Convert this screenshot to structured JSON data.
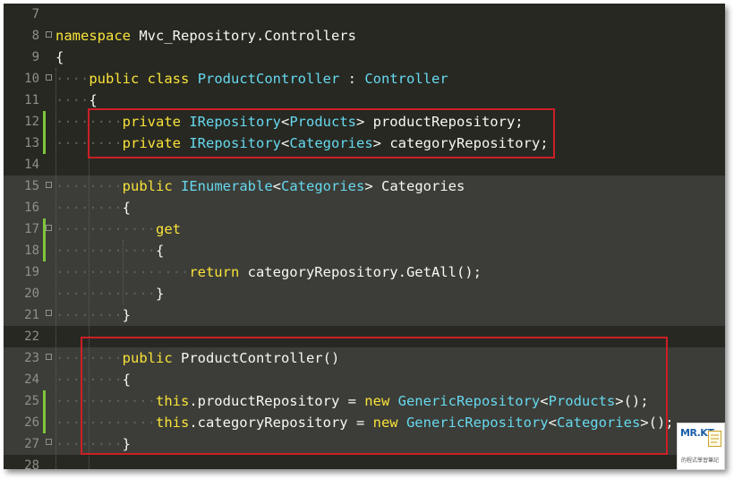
{
  "editor": {
    "lines": [
      {
        "num": "7",
        "indent": 0,
        "tokens": []
      },
      {
        "num": "8",
        "indent": 0,
        "fold": "open",
        "tokens": [
          {
            "t": "namespace",
            "c": "kw"
          },
          {
            "t": " Mvc_Repository.Controllers",
            "c": "pl"
          }
        ]
      },
      {
        "num": "9",
        "indent": 0,
        "tokens": [
          {
            "t": "{",
            "c": "pl"
          }
        ]
      },
      {
        "num": "10",
        "indent": 1,
        "fold": "open",
        "tokens": [
          {
            "t": "public",
            "c": "kw"
          },
          {
            "t": " ",
            "c": "pl"
          },
          {
            "t": "class",
            "c": "kw"
          },
          {
            "t": " ",
            "c": "pl"
          },
          {
            "t": "ProductController",
            "c": "ty"
          },
          {
            "t": " : ",
            "c": "pl"
          },
          {
            "t": "Controller",
            "c": "ty"
          }
        ]
      },
      {
        "num": "11",
        "indent": 1,
        "tokens": [
          {
            "t": "{",
            "c": "pl"
          }
        ]
      },
      {
        "num": "12",
        "indent": 2,
        "modified": true,
        "tokens": [
          {
            "t": "private",
            "c": "kw"
          },
          {
            "t": " ",
            "c": "pl"
          },
          {
            "t": "IRepository",
            "c": "ty"
          },
          {
            "t": "<",
            "c": "pl"
          },
          {
            "t": "Products",
            "c": "ty"
          },
          {
            "t": "> productRepository;",
            "c": "pl"
          }
        ]
      },
      {
        "num": "13",
        "indent": 2,
        "modified": true,
        "tokens": [
          {
            "t": "private",
            "c": "kw"
          },
          {
            "t": " ",
            "c": "pl"
          },
          {
            "t": "IRepository",
            "c": "ty"
          },
          {
            "t": "<",
            "c": "pl"
          },
          {
            "t": "Categories",
            "c": "ty"
          },
          {
            "t": "> categoryRepository;",
            "c": "pl"
          }
        ]
      },
      {
        "num": "14",
        "indent": 0,
        "tokens": []
      },
      {
        "num": "15",
        "indent": 2,
        "highlight": true,
        "fold": "open",
        "tokens": [
          {
            "t": "public",
            "c": "kw"
          },
          {
            "t": " ",
            "c": "pl"
          },
          {
            "t": "IEnumerable",
            "c": "ty"
          },
          {
            "t": "<",
            "c": "pl"
          },
          {
            "t": "Categories",
            "c": "ty"
          },
          {
            "t": "> Categories",
            "c": "pl"
          }
        ]
      },
      {
        "num": "16",
        "indent": 2,
        "highlight": true,
        "tokens": [
          {
            "t": "{",
            "c": "pl"
          }
        ]
      },
      {
        "num": "17",
        "indent": 3,
        "highlight": true,
        "modified": true,
        "fold": "open",
        "tokens": [
          {
            "t": "get",
            "c": "kw"
          }
        ]
      },
      {
        "num": "18",
        "indent": 3,
        "highlight": true,
        "modified": true,
        "tokens": [
          {
            "t": "{",
            "c": "pl"
          }
        ]
      },
      {
        "num": "19",
        "indent": 4,
        "highlight": true,
        "tokens": [
          {
            "t": "return",
            "c": "kw"
          },
          {
            "t": " categoryRepository.GetAll();",
            "c": "pl"
          }
        ]
      },
      {
        "num": "20",
        "indent": 3,
        "highlight": true,
        "tokens": [
          {
            "t": "}",
            "c": "pl"
          }
        ]
      },
      {
        "num": "21",
        "indent": 2,
        "highlight": true,
        "fold": "end",
        "tokens": [
          {
            "t": "}",
            "c": "pl"
          }
        ]
      },
      {
        "num": "22",
        "indent": 0,
        "tokens": []
      },
      {
        "num": "23",
        "indent": 2,
        "highlight": true,
        "fold": "open",
        "tokens": [
          {
            "t": "public",
            "c": "kw"
          },
          {
            "t": " ProductController()",
            "c": "pl"
          }
        ]
      },
      {
        "num": "24",
        "indent": 2,
        "highlight": true,
        "tokens": [
          {
            "t": "{",
            "c": "pl"
          }
        ]
      },
      {
        "num": "25",
        "indent": 3,
        "highlight": true,
        "modified": true,
        "tokens": [
          {
            "t": "this",
            "c": "kw"
          },
          {
            "t": ".productRepository = ",
            "c": "pl"
          },
          {
            "t": "new",
            "c": "kw"
          },
          {
            "t": " ",
            "c": "pl"
          },
          {
            "t": "GenericRepository",
            "c": "ty"
          },
          {
            "t": "<",
            "c": "pl"
          },
          {
            "t": "Products",
            "c": "ty"
          },
          {
            "t": ">();",
            "c": "pl"
          }
        ]
      },
      {
        "num": "26",
        "indent": 3,
        "highlight": true,
        "modified": true,
        "tokens": [
          {
            "t": "this",
            "c": "kw"
          },
          {
            "t": ".categoryRepository = ",
            "c": "pl"
          },
          {
            "t": "new",
            "c": "kw"
          },
          {
            "t": " ",
            "c": "pl"
          },
          {
            "t": "GenericRepository",
            "c": "ty"
          },
          {
            "t": "<",
            "c": "pl"
          },
          {
            "t": "Categories",
            "c": "ty"
          },
          {
            "t": ">();",
            "c": "pl"
          }
        ]
      },
      {
        "num": "27",
        "indent": 2,
        "highlight": true,
        "fold": "end",
        "tokens": [
          {
            "t": "}",
            "c": "pl"
          }
        ]
      },
      {
        "num": "28",
        "indent": 0,
        "tokens": []
      }
    ],
    "colors": {
      "background": "#272822",
      "keyword": "#f9e33a",
      "type": "#66d9ef",
      "plain": "#f8f8f2",
      "line_number": "#8f908a",
      "current_block": "#3c3d38",
      "modified_marker": "#7ec63a",
      "annotation_box": "#cc1f25"
    }
  },
  "annotations": [
    {
      "label": "field-declarations",
      "lines": [
        "12",
        "13"
      ]
    },
    {
      "label": "constructor",
      "lines": [
        "23",
        "27"
      ]
    }
  ],
  "watermark": {
    "text": "MR.KT",
    "subtitle": "的程式學習筆記"
  }
}
